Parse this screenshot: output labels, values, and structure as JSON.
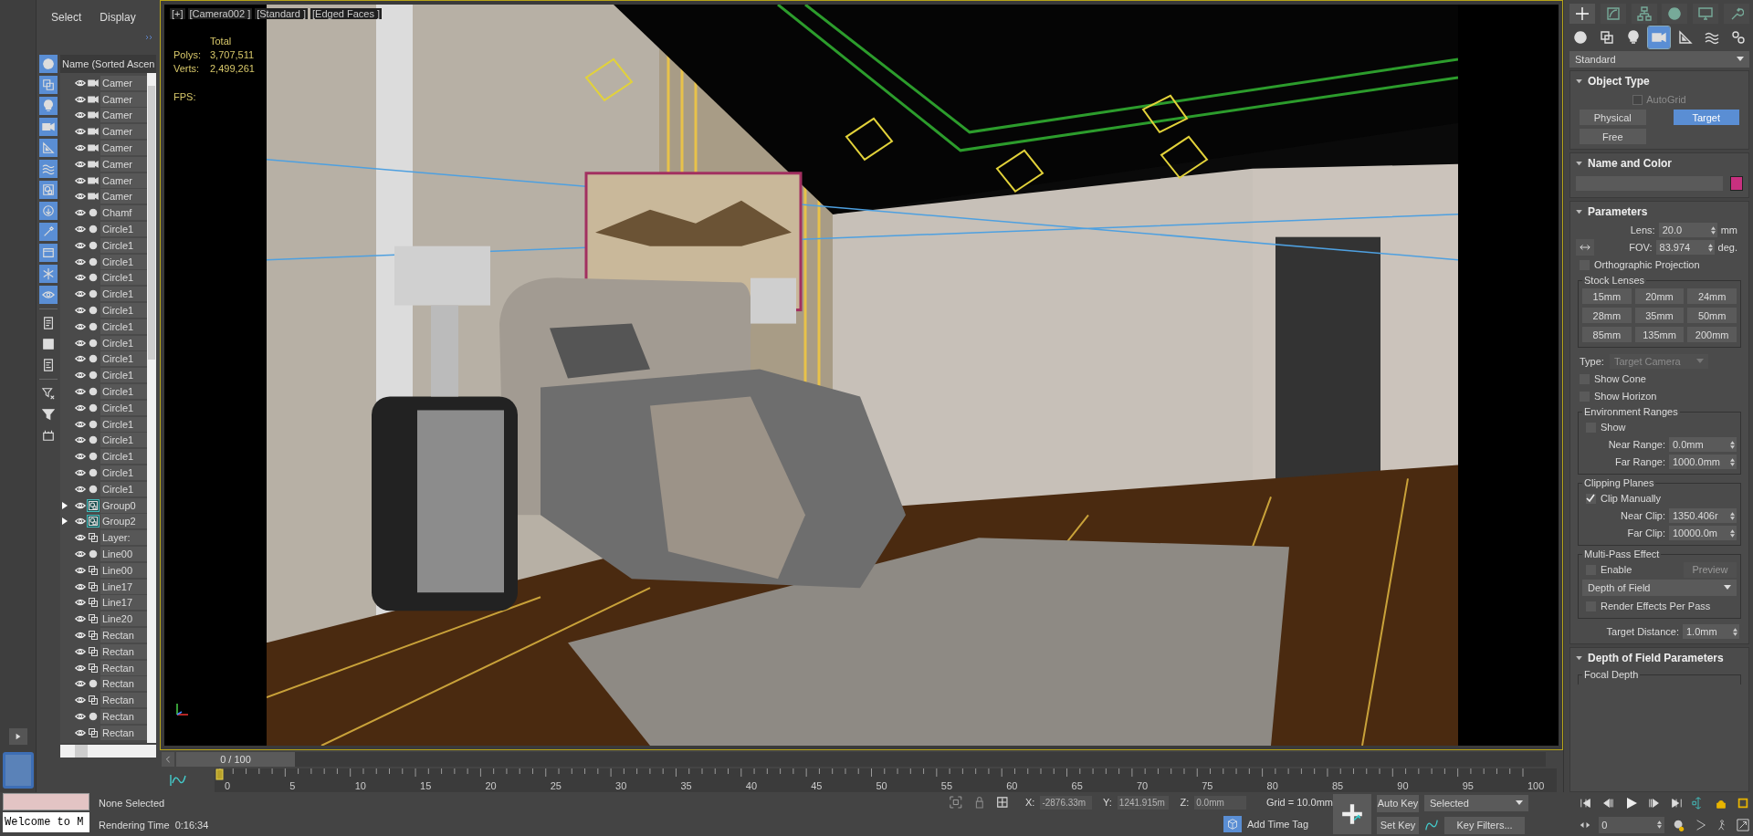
{
  "explorer": {
    "menu": [
      "Select",
      "Display"
    ],
    "header": "Name (Sorted Ascen",
    "filters": [
      {
        "kind": "geometry",
        "selected": true
      },
      {
        "kind": "shapes",
        "selected": true
      },
      {
        "kind": "lights",
        "selected": true
      },
      {
        "kind": "cameras",
        "selected": true
      },
      {
        "kind": "helpers",
        "selected": true
      },
      {
        "kind": "spacewarps",
        "selected": true
      },
      {
        "kind": "groups",
        "selected": true
      },
      {
        "kind": "xrefs",
        "selected": true
      },
      {
        "kind": "bones",
        "selected": true
      },
      {
        "kind": "containers",
        "selected": true
      },
      {
        "kind": "frozen",
        "selected": true
      },
      {
        "kind": "hidden",
        "selected": true
      },
      {
        "kind": "layers",
        "selected": false
      },
      {
        "kind": "all",
        "selected": false
      },
      {
        "kind": "none",
        "selected": false
      },
      {
        "kind": "filter_off",
        "selected": false
      },
      {
        "kind": "filter",
        "selected": false
      },
      {
        "kind": "container_box",
        "selected": false
      }
    ],
    "rows": [
      {
        "name": "Camer",
        "kind": "camera"
      },
      {
        "name": "Camer",
        "kind": "camera"
      },
      {
        "name": "Camer",
        "kind": "camera"
      },
      {
        "name": "Camer",
        "kind": "camera"
      },
      {
        "name": "Camer",
        "kind": "camera"
      },
      {
        "name": "Camer",
        "kind": "camera"
      },
      {
        "name": "Camer",
        "kind": "camera"
      },
      {
        "name": "Camer",
        "kind": "camera"
      },
      {
        "name": "Chamf",
        "kind": "object"
      },
      {
        "name": "Circle1",
        "kind": "object"
      },
      {
        "name": "Circle1",
        "kind": "object"
      },
      {
        "name": "Circle1",
        "kind": "object"
      },
      {
        "name": "Circle1",
        "kind": "object"
      },
      {
        "name": "Circle1",
        "kind": "object"
      },
      {
        "name": "Circle1",
        "kind": "object"
      },
      {
        "name": "Circle1",
        "kind": "object"
      },
      {
        "name": "Circle1",
        "kind": "object"
      },
      {
        "name": "Circle1",
        "kind": "object"
      },
      {
        "name": "Circle1",
        "kind": "object"
      },
      {
        "name": "Circle1",
        "kind": "object"
      },
      {
        "name": "Circle1",
        "kind": "object"
      },
      {
        "name": "Circle1",
        "kind": "object"
      },
      {
        "name": "Circle1",
        "kind": "object"
      },
      {
        "name": "Circle1",
        "kind": "object"
      },
      {
        "name": "Circle1",
        "kind": "object"
      },
      {
        "name": "Circle1",
        "kind": "object"
      },
      {
        "name": "Group0",
        "kind": "group",
        "expanded": false
      },
      {
        "name": "Group2",
        "kind": "group",
        "expanded": false
      },
      {
        "name": "Layer:",
        "kind": "shape"
      },
      {
        "name": "Line00",
        "kind": "object"
      },
      {
        "name": "Line00",
        "kind": "shape"
      },
      {
        "name": "Line17",
        "kind": "shape"
      },
      {
        "name": "Line17",
        "kind": "shape"
      },
      {
        "name": "Line20",
        "kind": "shape"
      },
      {
        "name": "Rectan",
        "kind": "shape"
      },
      {
        "name": "Rectan",
        "kind": "shape"
      },
      {
        "name": "Rectan",
        "kind": "shape"
      },
      {
        "name": "Rectan",
        "kind": "object"
      },
      {
        "name": "Rectan",
        "kind": "shape"
      },
      {
        "name": "Rectan",
        "kind": "object"
      },
      {
        "name": "Rectan",
        "kind": "shape"
      }
    ]
  },
  "viewport": {
    "labels": [
      "[+]",
      "[Camera002 ]",
      "[Standard ]",
      "[Edged Faces ]"
    ],
    "total_label": "Total",
    "stats": [
      {
        "label": "Polys:",
        "value": "3,707,511"
      },
      {
        "label": "Verts:",
        "value": "2,499,261"
      }
    ],
    "fps_label": "FPS:"
  },
  "timeline": {
    "slider": {
      "label": "0 / 100",
      "level": 0
    },
    "ticks": [
      "0",
      "5",
      "10",
      "15",
      "20",
      "25",
      "30",
      "35",
      "40",
      "45",
      "50",
      "55",
      "60",
      "65",
      "70",
      "75",
      "80",
      "85",
      "90",
      "95",
      "100"
    ]
  },
  "command_panel": {
    "tabs": [
      {
        "kind": "create",
        "selected": true
      },
      {
        "kind": "modify",
        "selected": false
      },
      {
        "kind": "hierarchy",
        "selected": false
      },
      {
        "kind": "motion",
        "selected": false
      },
      {
        "kind": "display",
        "selected": false
      },
      {
        "kind": "utilities",
        "selected": false
      }
    ],
    "categories": [
      {
        "kind": "geometry",
        "selected": false
      },
      {
        "kind": "shapes",
        "selected": false
      },
      {
        "kind": "lights",
        "selected": false
      },
      {
        "kind": "cameras",
        "selected": true
      },
      {
        "kind": "helpers",
        "selected": false
      },
      {
        "kind": "spacewarps",
        "selected": false
      },
      {
        "kind": "systems",
        "selected": false
      }
    ],
    "type_dropdown": "Standard",
    "object_type": {
      "title": "Object Type",
      "autogrid": {
        "label": "AutoGrid",
        "checked": false,
        "disabled": true
      },
      "buttons": [
        {
          "label": "Physical",
          "selected": false
        },
        {
          "label": "Target",
          "selected": true
        },
        {
          "label": "Free",
          "selected": false
        }
      ]
    },
    "name_and_color": {
      "title": "Name and Color",
      "color": "#c8307f"
    },
    "parameters": {
      "title": "Parameters",
      "lens": {
        "label": "Lens:",
        "value": "20.0",
        "unit": "mm"
      },
      "fov": {
        "label": "FOV:",
        "value": "83.974",
        "unit": "deg."
      },
      "orthographic": {
        "label": "Orthographic Projection",
        "checked": false
      },
      "stock_lenses": {
        "title": "Stock Lenses",
        "buttons": [
          "15mm",
          "20mm",
          "24mm",
          "28mm",
          "35mm",
          "50mm",
          "85mm",
          "135mm",
          "200mm"
        ]
      },
      "type": {
        "label": "Type:",
        "value": "Target Camera",
        "disabled": true
      },
      "show_cone": {
        "label": "Show Cone",
        "checked": false
      },
      "show_horizon": {
        "label": "Show Horizon",
        "checked": false
      },
      "environment_ranges": {
        "title": "Environment Ranges",
        "show": {
          "label": "Show",
          "checked": false
        },
        "near": {
          "label": "Near Range:",
          "value": "0.0mm"
        },
        "far": {
          "label": "Far Range:",
          "value": "1000.0mm"
        }
      },
      "clipping": {
        "title": "Clipping Planes",
        "clip_manually": {
          "label": "Clip Manually",
          "checked": true
        },
        "near": {
          "label": "Near Clip:",
          "value": "1350.406r"
        },
        "far": {
          "label": "Far Clip:",
          "value": "10000.0m"
        }
      },
      "multipass": {
        "title": "Multi-Pass Effect",
        "enable": {
          "label": "Enable",
          "checked": false
        },
        "preview": {
          "label": "Preview",
          "disabled": true
        },
        "effect": "Depth of Field",
        "render_per_pass": {
          "label": "Render Effects Per Pass",
          "checked": false
        }
      },
      "target_distance": {
        "label": "Target Distance:",
        "value": "1.0mm"
      }
    },
    "dof": {
      "title": "Depth of Field Parameters",
      "group": "Focal Depth"
    }
  },
  "status": {
    "welcome": "Welcome to M",
    "selection": "None Selected",
    "render_time": {
      "label": "Rendering Time",
      "value": "0:16:34"
    },
    "coords": [
      {
        "label": "X:",
        "value": "-2876.33m"
      },
      {
        "label": "Y:",
        "value": "1241.915m"
      },
      {
        "label": "Z:",
        "value": "0.0mm"
      }
    ],
    "grid": "Grid = 10.0mm",
    "add_time_tag": "Add Time Tag",
    "auto_key": "Auto Key",
    "set_key": "Set Key",
    "key_mode": "Selected",
    "key_filters": "Key Filters...",
    "frame": "0"
  }
}
